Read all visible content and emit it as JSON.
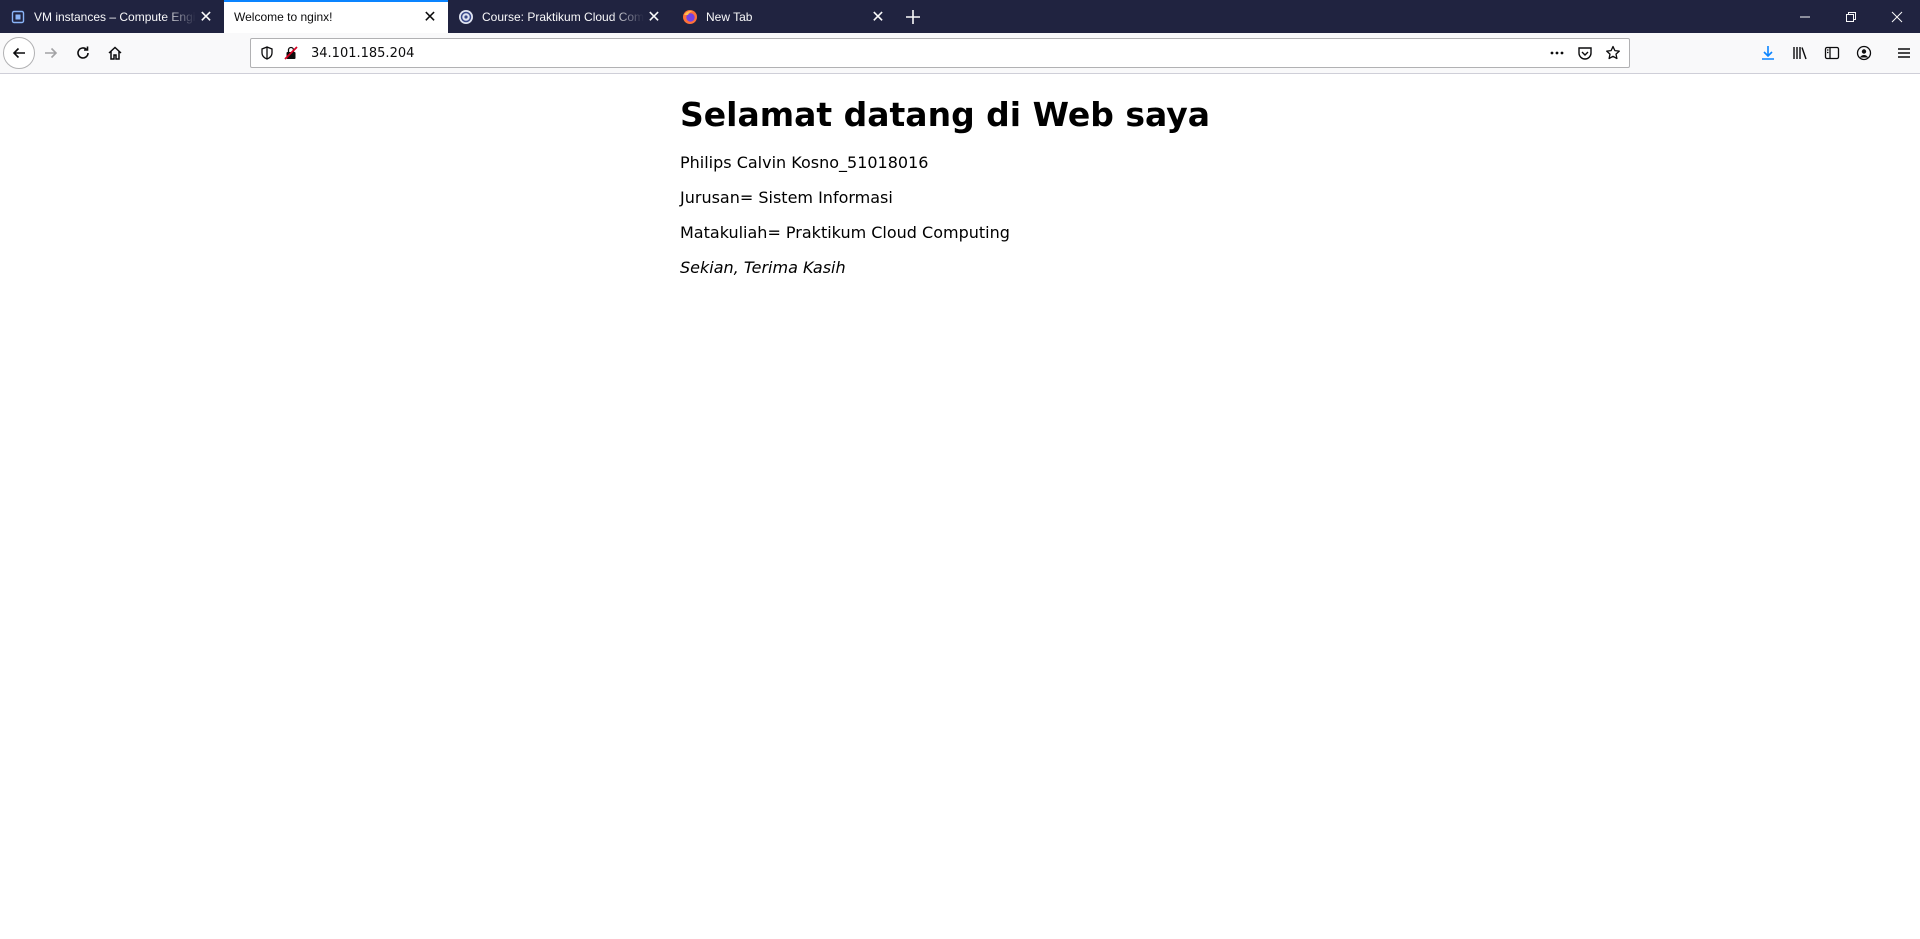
{
  "tabs": [
    {
      "title": "VM instances – Compute Engine",
      "active": false,
      "icon": "compute-engine-icon"
    },
    {
      "title": "Welcome to nginx!",
      "active": true,
      "icon": "none"
    },
    {
      "title": "Course: Praktikum Cloud Computing",
      "active": false,
      "icon": "course-icon"
    },
    {
      "title": "New Tab",
      "active": false,
      "icon": "firefox-icon"
    }
  ],
  "urlbar": {
    "url": "34.101.185.204"
  },
  "page": {
    "heading": "Selamat datang di Web saya",
    "paragraphs": [
      "Philips Calvin Kosno_51018016",
      "Jurusan= Sistem Informasi",
      "Matakuliah= Praktikum Cloud Computing"
    ],
    "closing": "Sekian, Terima Kasih"
  },
  "colors": {
    "tabstrip": "#202340",
    "active_tab_indicator": "#0a84ff",
    "download_accent": "#0a84ff"
  }
}
